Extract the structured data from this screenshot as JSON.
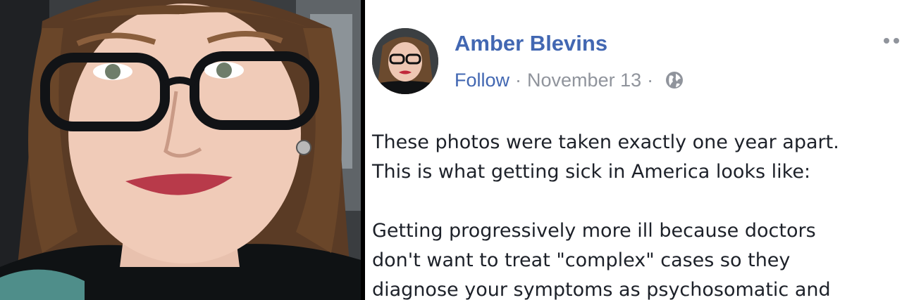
{
  "post": {
    "author_name": "Amber Blevins",
    "follow_label": "Follow",
    "separator": "·",
    "date": "November 13",
    "privacy_icon": "globe-icon",
    "more_icon": "more-options-icon",
    "paragraphs": [
      {
        "lines": [
          "These photos were taken exactly one year apart.",
          "This is what getting sick in America looks like:"
        ]
      },
      {
        "lines": [
          "Getting progressively more ill because doctors",
          "don't want to treat \"complex\" cases so they",
          "diagnose your symptoms as psychosomatic and"
        ]
      }
    ]
  },
  "colors": {
    "link_blue": "#4267b2",
    "meta_gray": "#90949c",
    "body_text": "#1d2129",
    "divider": "#000000"
  },
  "photo": {
    "subject": "woman with glasses smiling",
    "alt_icon": "portrait-photo"
  }
}
